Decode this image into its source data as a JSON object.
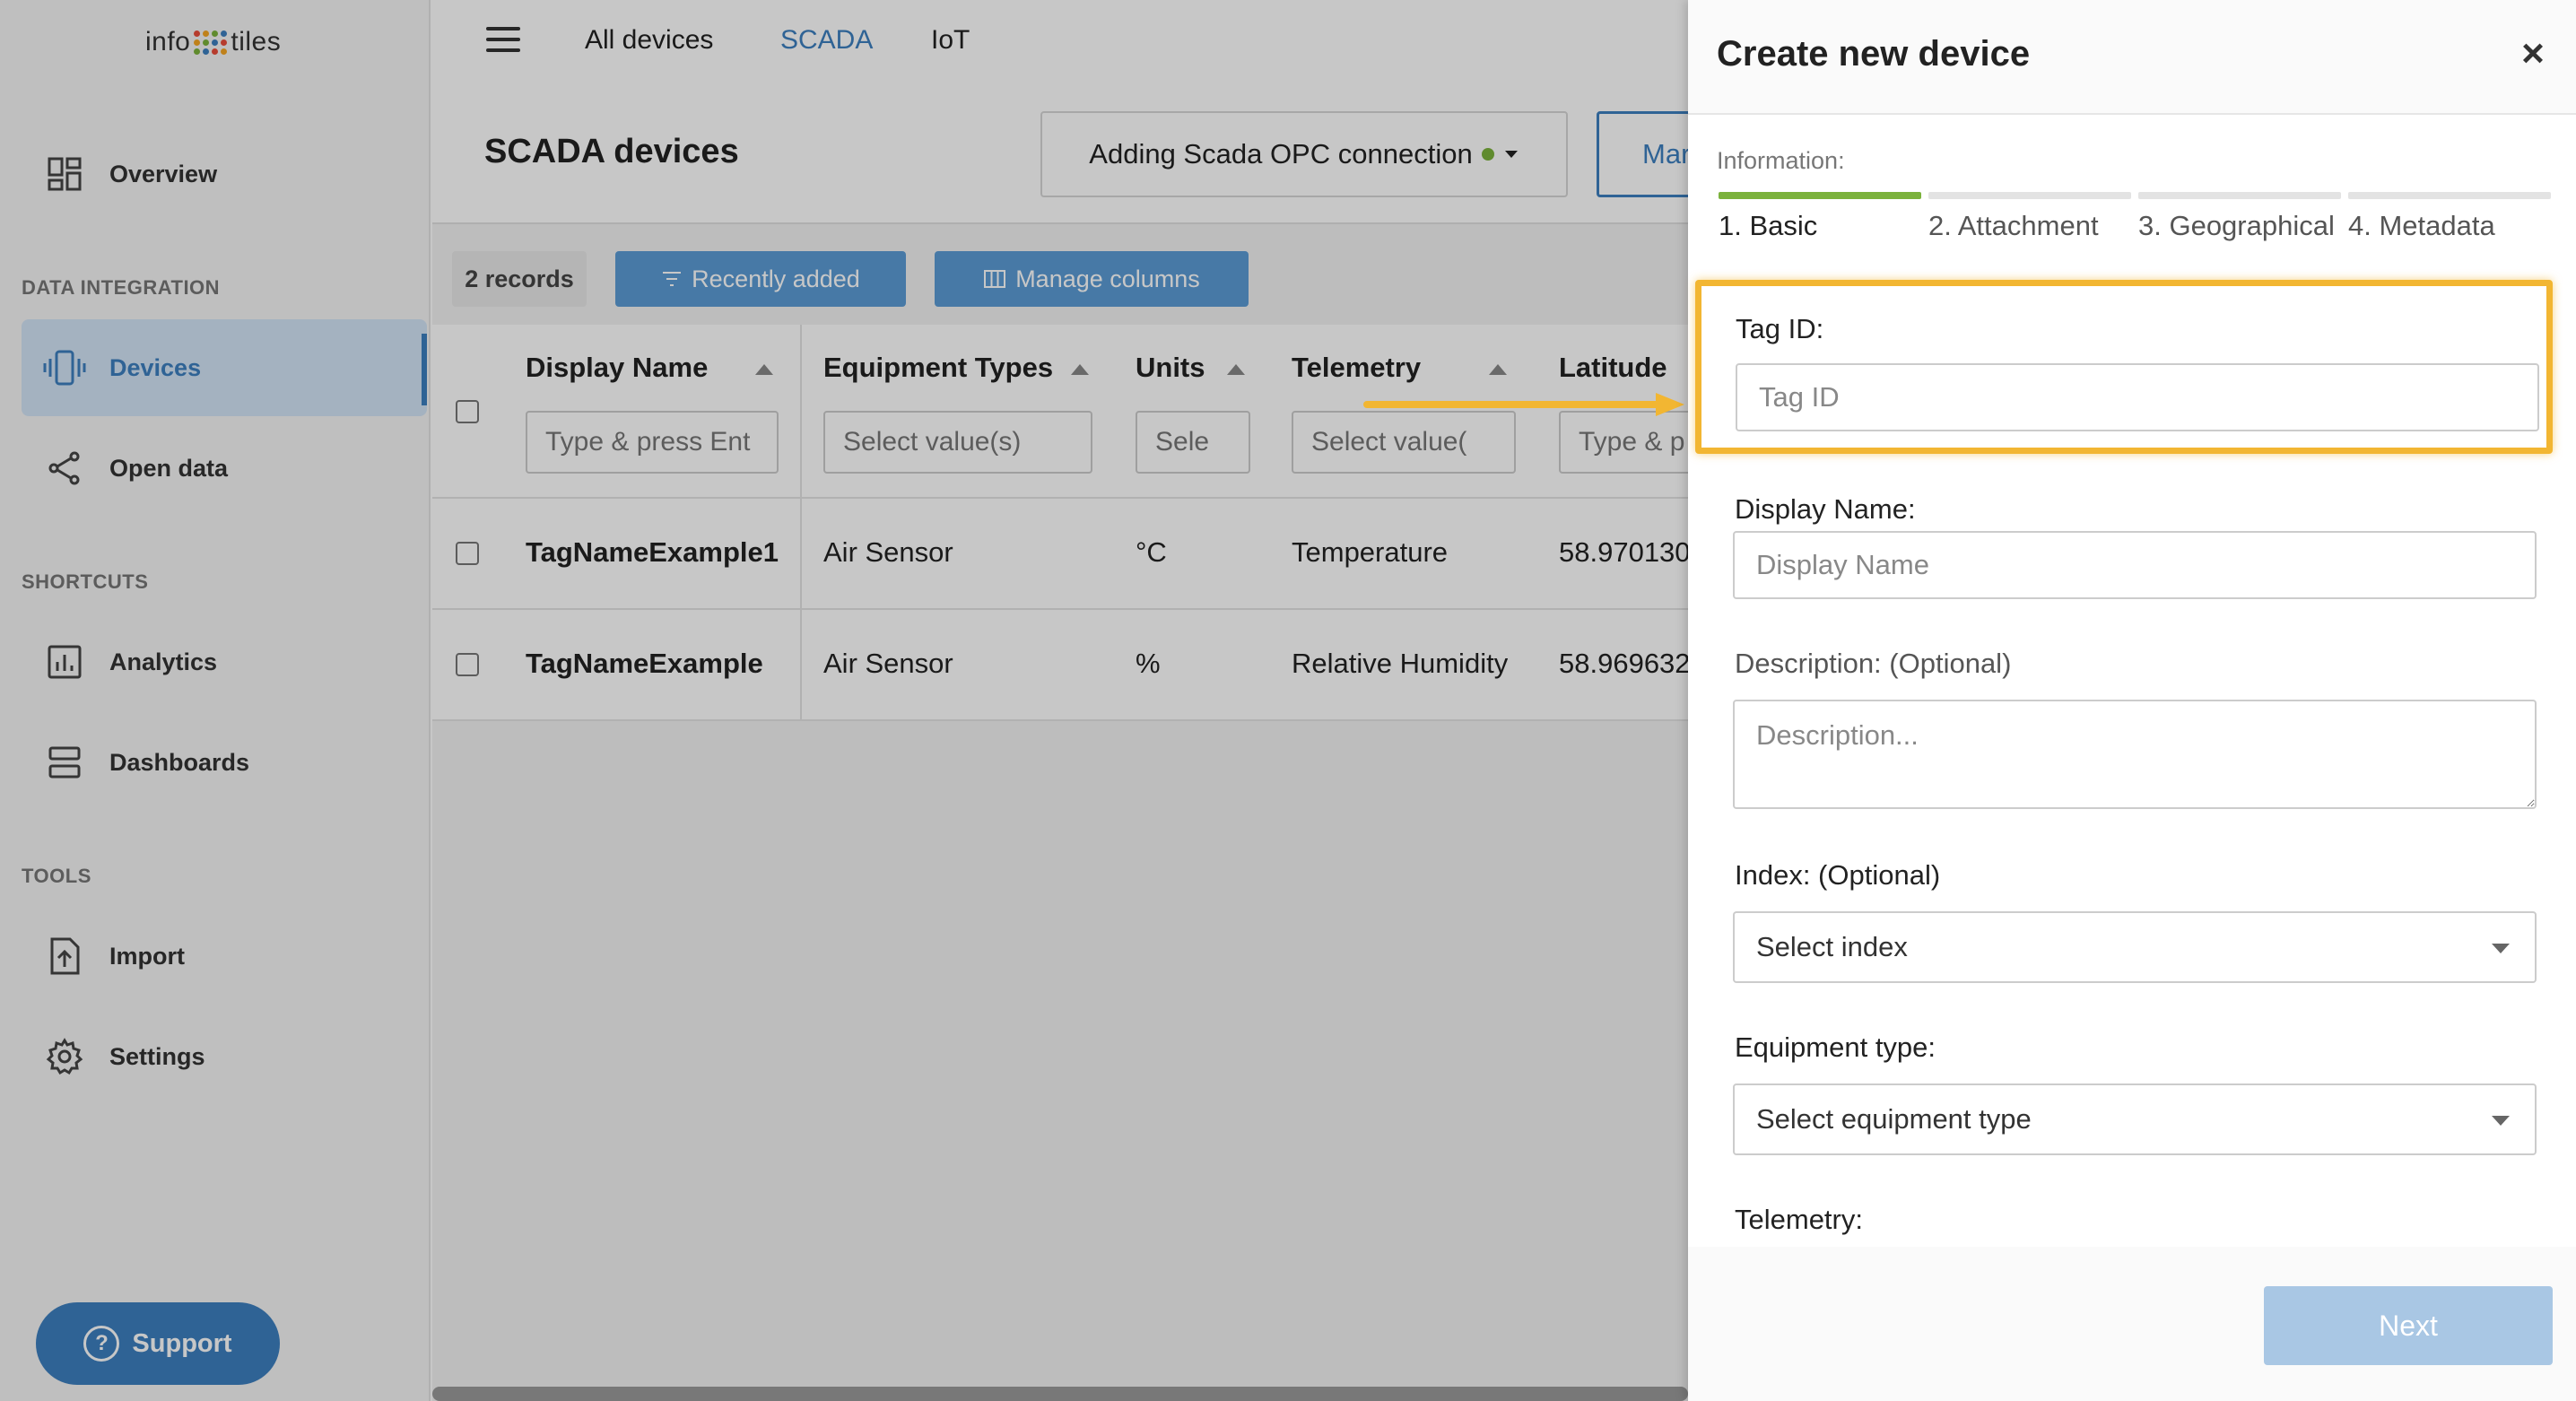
{
  "logo": {
    "left": "info",
    "right": "tiles",
    "dot_colors": [
      "#e94e3b",
      "#f5a623",
      "#7bb23c",
      "#3d7fbf"
    ]
  },
  "sidebar": {
    "overview": "Overview",
    "section_data": "DATA INTEGRATION",
    "devices": "Devices",
    "open_data": "Open data",
    "section_shortcuts": "SHORTCUTS",
    "analytics": "Analytics",
    "dashboards": "Dashboards",
    "section_tools": "TOOLS",
    "import": "Import",
    "settings": "Settings",
    "support": "Support"
  },
  "topnav": {
    "tabs": [
      "All devices",
      "SCADA",
      "IoT"
    ],
    "selected": "SCADA"
  },
  "page": {
    "title": "SCADA devices",
    "connection": "Adding Scada OPC connection",
    "manage_btn_partial": "Mar",
    "records": "2 records",
    "recently_added": "Recently added",
    "manage_columns": "Manage columns"
  },
  "table": {
    "columns": [
      {
        "title": "Display Name",
        "filter": "Type & press Ent"
      },
      {
        "title": "Equipment Types",
        "filter": "Select value(s)"
      },
      {
        "title": "Units",
        "filter": "Sele"
      },
      {
        "title": "Telemetry",
        "filter": "Select value("
      },
      {
        "title": "Latitude",
        "filter": "Type & p"
      }
    ],
    "rows": [
      [
        "TagNameExample1",
        "Air Sensor",
        "°C",
        "Temperature",
        "58.970130"
      ],
      [
        "TagNameExample",
        "Air Sensor",
        "%",
        "Relative Humidity",
        "58.969632"
      ]
    ]
  },
  "drawer": {
    "title": "Create new device",
    "info_label": "Information:",
    "steps": [
      "1. Basic",
      "2. Attachment",
      "3. Geographical",
      "4. Metadata"
    ],
    "fields": {
      "tag_id_label": "Tag ID:",
      "tag_id_placeholder": "Tag ID",
      "display_name_label": "Display Name:",
      "display_name_placeholder": "Display Name",
      "description_label": "Description: (Optional)",
      "description_placeholder": "Description...",
      "index_label": "Index: (Optional)",
      "index_value": "Select index",
      "equipment_label": "Equipment type:",
      "equipment_value": "Select equipment type",
      "telemetry_label": "Telemetry:"
    },
    "next": "Next"
  },
  "colors": {
    "accent": "#3d7fbf",
    "step_active": "#7bb23c",
    "highlight": "#f2b632",
    "status_dot": "#7bb23c"
  }
}
